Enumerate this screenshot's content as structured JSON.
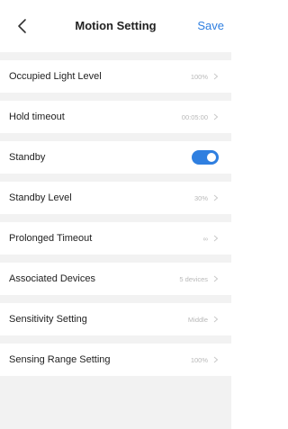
{
  "header": {
    "back_icon": "chevron-left-icon",
    "title": "Motion Setting",
    "save_label": "Save",
    "accent_color": "#2f7fe0"
  },
  "settings": [
    {
      "label": "Occupied Light Level",
      "value": "100%"
    },
    {
      "label": "Hold timeout",
      "value": "00:05:00"
    },
    {
      "label": "Standby",
      "toggle": true
    },
    {
      "label": "Standby Level",
      "value": "30%"
    },
    {
      "label": "Prolonged Timeout",
      "value": "∞"
    },
    {
      "label": "Associated Devices",
      "value": "5 devices"
    },
    {
      "label": "Sensitivity Setting",
      "value": "Middle"
    },
    {
      "label": "Sensing Range Setting",
      "value": "100%"
    }
  ]
}
